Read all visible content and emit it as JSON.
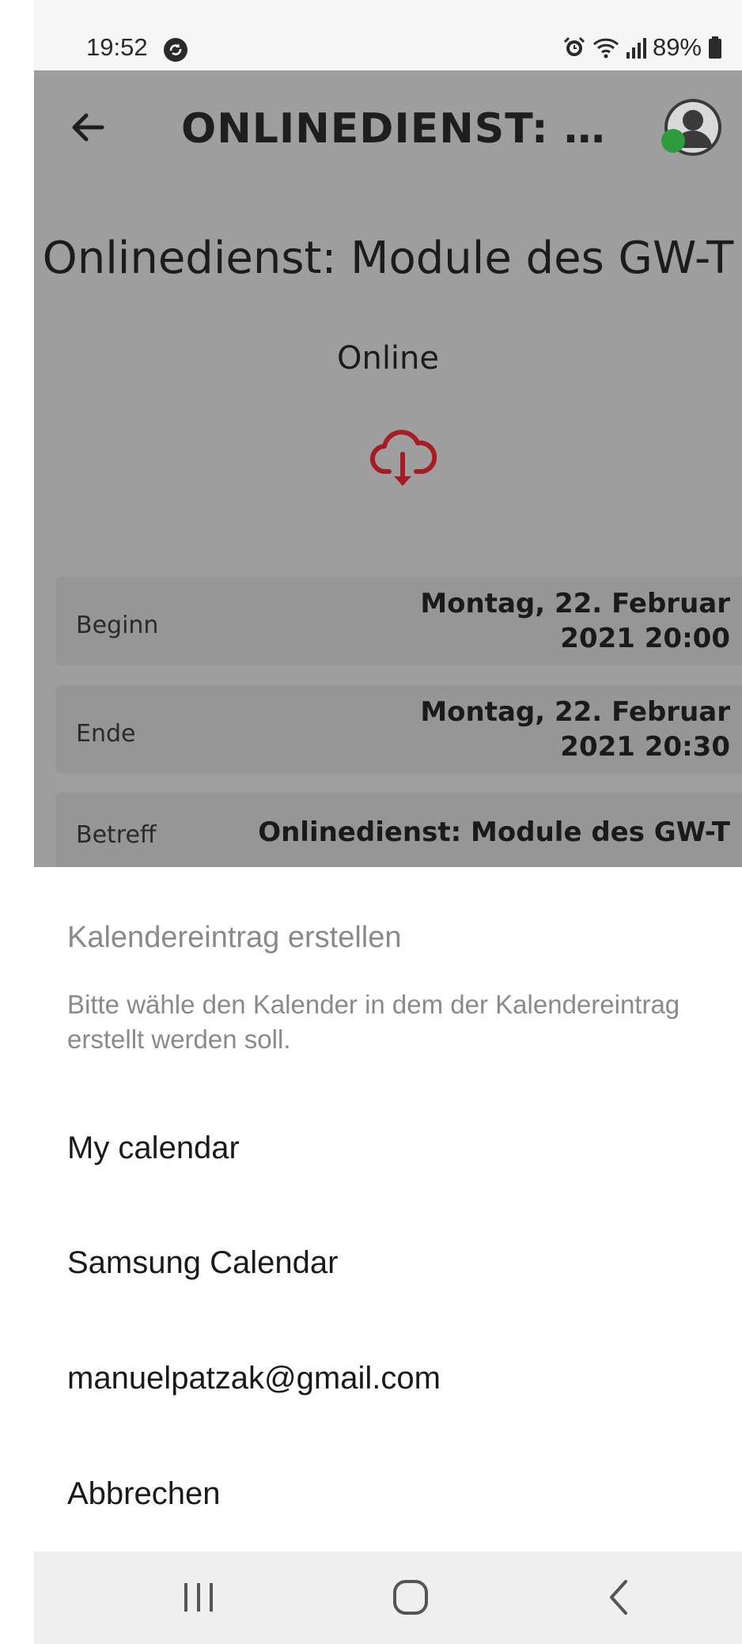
{
  "status_bar": {
    "time": "19:52",
    "battery_percent": "89%",
    "icons": [
      "sync-icon",
      "alarm-icon",
      "wifi-icon",
      "signal-icon",
      "battery-icon"
    ]
  },
  "header": {
    "title": "ONLINEDIENST: M...",
    "back_icon": "arrow-left-icon",
    "avatar_icon": "person-avatar-icon",
    "online_status_color": "#2e9b3d"
  },
  "event": {
    "title": "Onlinedienst: Module des GW-T",
    "location": "Online",
    "download_icon": "cloud-download-icon",
    "accent_color": "#a51c24",
    "details": [
      {
        "label": "Beginn",
        "value": "Montag, 22. Februar 2021 20:00"
      },
      {
        "label": "Ende",
        "value": "Montag, 22. Februar 2021 20:30"
      },
      {
        "label": "Betreff",
        "value": "Onlinedienst: Module des GW-T"
      }
    ]
  },
  "dialog": {
    "title": "Kalendereintrag erstellen",
    "message": "Bitte wähle den Kalender in dem der Kalendereintrag erstellt werden soll.",
    "options": [
      "My calendar",
      "Samsung Calendar",
      "manuelpatzak@gmail.com"
    ],
    "cancel": "Abbrechen"
  },
  "nav_bar": {
    "icons": [
      "recent-apps-icon",
      "home-icon",
      "back-icon"
    ]
  }
}
